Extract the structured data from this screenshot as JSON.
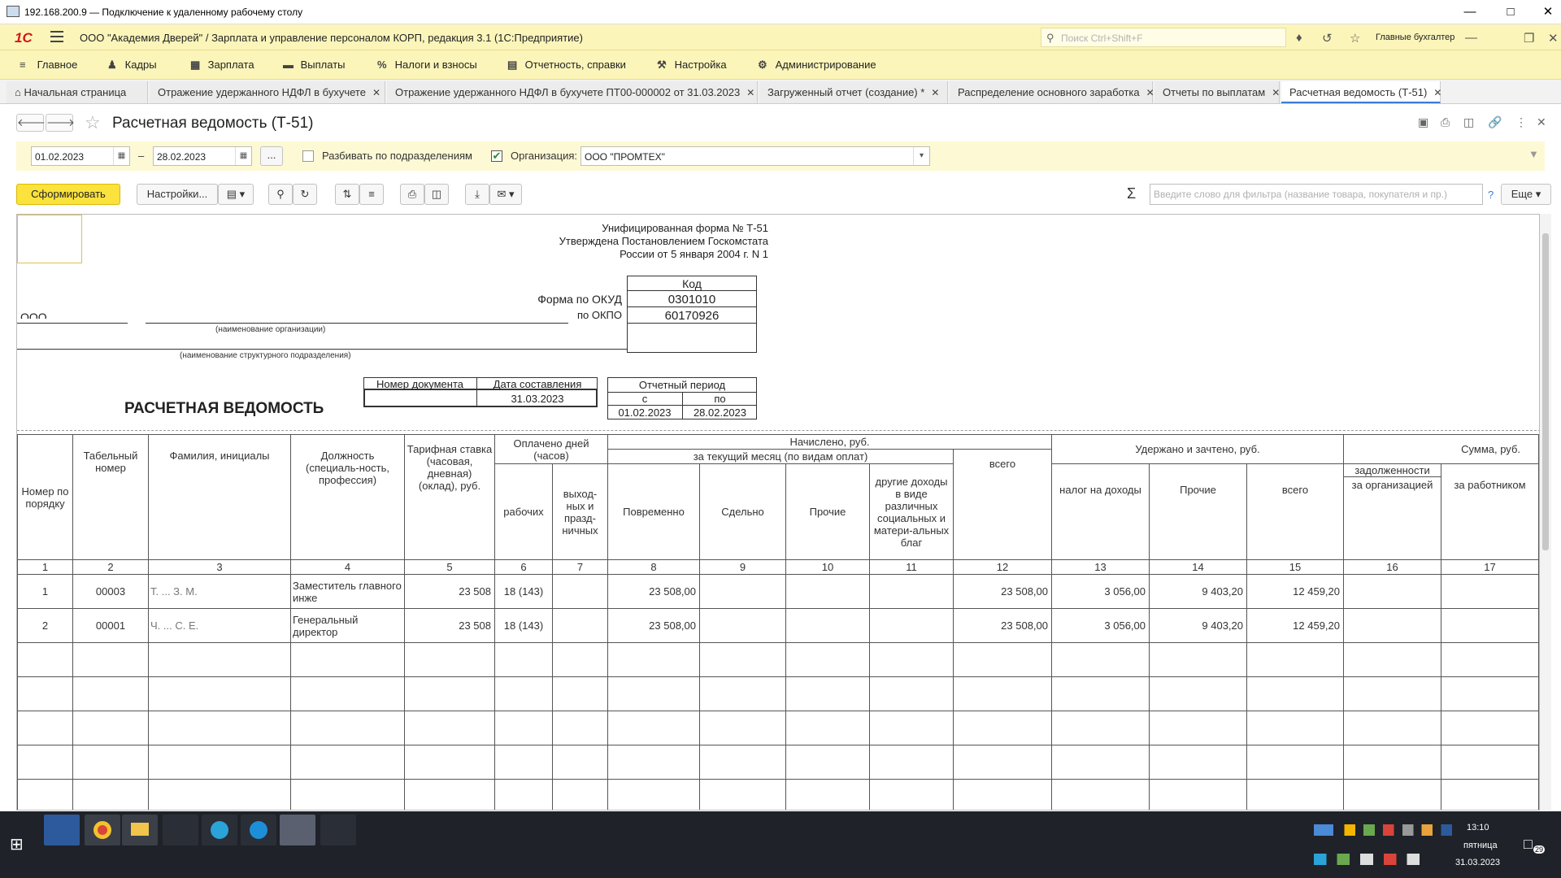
{
  "rdp": {
    "title": "192.168.200.9 — Подключение к удаленному рабочему столу"
  },
  "header": {
    "app_title": "ООО \"Академия Дверей\" / Зарплата и управление персоналом КОРП, редакция 3.1  (1С:Предприятие)",
    "search_placeholder": "Поиск Ctrl+Shift+F",
    "user": "Главные бухгалтер"
  },
  "sections": [
    "Главное",
    "Кадры",
    "Зарплата",
    "Выплаты",
    "Налоги и взносы",
    "Отчетность, справки",
    "Настройка",
    "Администрирование"
  ],
  "tabs": [
    {
      "label": "Начальная страница"
    },
    {
      "label": "Отражение удержанного НДФЛ в бухучете"
    },
    {
      "label": "Отражение удержанного НДФЛ в бухучете ПТ00-000002 от 31.03.2023"
    },
    {
      "label": "Загруженный отчет (создание) *"
    },
    {
      "label": "Распределение основного заработка"
    },
    {
      "label": "Отчеты по выплатам"
    },
    {
      "label": "Расчетная ведомость (Т-51)"
    }
  ],
  "form": {
    "title": "Расчетная ведомость (Т-51)",
    "date_from": "01.02.2023",
    "dash": "–",
    "date_to": "28.02.2023",
    "ellipsis": "...",
    "split_label": "Разбивать по подразделениям",
    "org_label": "Организация:",
    "org_value": "ООО \"ПРОМТЕХ\""
  },
  "toolbar": {
    "generate": "Сформировать",
    "settings": "Настройки...",
    "filter_placeholder": "Введите слово для фильтра (название товара, покупателя и пр.)",
    "help": "?",
    "more": "Еще"
  },
  "report": {
    "form_line1": "Унифицированная форма № Т-51",
    "form_line2": "Утверждена Постановлением Госкомстата",
    "form_line3": "России от 5 января 2004 г. N 1",
    "code_header": "Код",
    "okud_label": "Форма по ОКУД",
    "okud": "0301010",
    "okpo_label": "по ОКПО",
    "okpo": "60170926",
    "org_short": "ООО",
    "org_caption": "(наименование организации)",
    "dept_caption": "(наименование структурного подразделения)",
    "title": "РАСЧЕТНАЯ ВЕДОМОСТЬ",
    "doc_number_label": "Номер документа",
    "doc_date_label": "Дата составления",
    "doc_date": "31.03.2023",
    "period_label": "Отчетный период",
    "period_from_label": "с",
    "period_to_label": "по",
    "period_from": "01.02.2023",
    "period_to": "28.02.2023",
    "headers": {
      "n": "Номер по порядку",
      "tab": "Табельный номер",
      "fio": "Фамилия, инициалы",
      "pos": "Должность (специаль-ность, профессия)",
      "rate": "Тарифная ставка (часовая, дневная) (оклад), руб.",
      "paid": "Оплачено дней (часов)",
      "work": "рабочих",
      "holiday": "выход-ных и празд-ничных",
      "accrued": "Начислено, руб.",
      "current": "за текущий месяц (по видам оплат)",
      "time": "Повременно",
      "piece": "Сдельно",
      "other": "Прочие",
      "other_income": "другие доходы в виде различных социальных и матери-альных благ",
      "total": "всего",
      "withheld": "Удержано и зачтено, руб.",
      "tax": "налог на доходы",
      "w_other": "Прочие",
      "w_total": "всего",
      "sum": "Сумма, руб.",
      "debt": "задолженности",
      "by_org": "за организацией",
      "by_emp": "за работником"
    },
    "col_numbers": [
      "1",
      "2",
      "3",
      "4",
      "5",
      "6",
      "7",
      "8",
      "9",
      "10",
      "11",
      "12",
      "13",
      "14",
      "15",
      "16",
      "17"
    ],
    "rows": [
      {
        "n": "1",
        "tab": "00003",
        "fio": "Т. ... З. М.",
        "pos": "Заместитель главного инже",
        "rate": "23 508",
        "days": "18 (143)",
        "time": "23 508,00",
        "total": "23 508,00",
        "tax": "3 056,00",
        "w_other": "9 403,20",
        "w_total": "12 459,20"
      },
      {
        "n": "2",
        "tab": "00001",
        "fio": "Ч. ... С. Е.",
        "pos": "Генеральный директор",
        "rate": "23 508",
        "days": "18 (143)",
        "time": "23 508,00",
        "total": "23 508,00",
        "tax": "3 056,00",
        "w_other": "9 403,20",
        "w_total": "12 459,20"
      }
    ]
  },
  "tray": {
    "time": "13:10",
    "day": "пятница",
    "date": "31.03.2023",
    "notif": "29"
  }
}
